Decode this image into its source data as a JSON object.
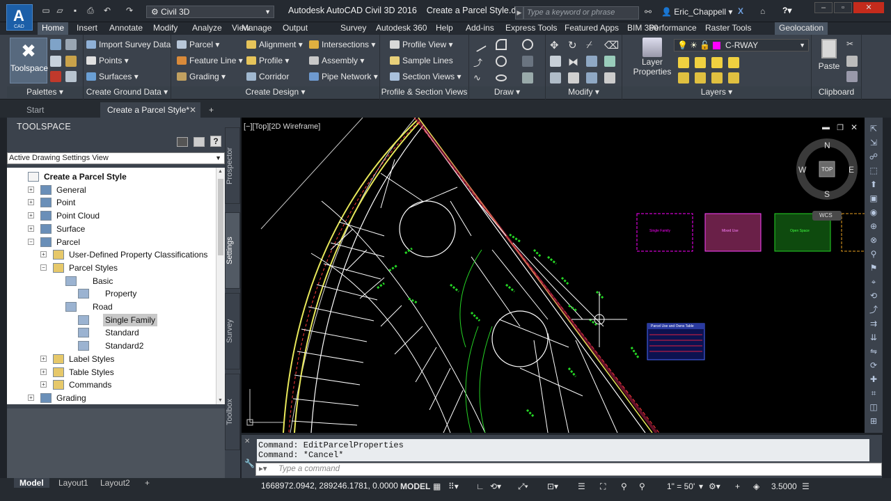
{
  "app": {
    "logo": "A",
    "logo_sub": "CAD",
    "title": "Autodesk AutoCAD Civil 3D 2016",
    "file": "Create a Parcel Style.dwg",
    "workspace": "Civil 3D",
    "search_placeholder": "Type a keyword or phrase",
    "user": "Eric_Chappell"
  },
  "ribbon_tabs": [
    "Home",
    "Insert",
    "Annotate",
    "Modify",
    "Analyze",
    "View",
    "Manage",
    "Output",
    "Survey",
    "Autodesk 360",
    "Help",
    "Add-ins",
    "Express Tools",
    "Featured Apps",
    "BIM 360",
    "Performance",
    "Raster Tools",
    "Geolocation"
  ],
  "ribbon": {
    "palettes": {
      "title": "Palettes",
      "toolspace": "Toolspace"
    },
    "ground": {
      "title": "Create Ground Data",
      "items": [
        "Import Survey Data",
        "Points",
        "Surfaces"
      ]
    },
    "design": {
      "title": "Create Design",
      "col1": [
        "Parcel",
        "Feature Line",
        "Grading"
      ],
      "col2": [
        "Alignment",
        "Profile",
        "Corridor"
      ],
      "col3": [
        "Intersections",
        "Assembly",
        "Pipe Network"
      ]
    },
    "profile": {
      "title": "Profile & Section Views",
      "items": [
        "Profile View",
        "Sample Lines",
        "Section Views"
      ]
    },
    "draw": {
      "title": "Draw"
    },
    "modify": {
      "title": "Modify"
    },
    "layers": {
      "title": "Layers",
      "props": "Layer Properties",
      "current": "C-RWAY"
    },
    "clipboard": {
      "title": "Clipboard",
      "paste": "Paste"
    }
  },
  "doc_tabs": {
    "start": "Start",
    "active": "Create a Parcel Style*"
  },
  "toolspace": {
    "title": "TOOLSPACE",
    "view": "Active Drawing Settings View",
    "tree": [
      {
        "label": "Create a Parcel Style",
        "bold": true
      },
      {
        "label": "General"
      },
      {
        "label": "Point"
      },
      {
        "label": "Point Cloud"
      },
      {
        "label": "Surface"
      },
      {
        "label": "Parcel"
      },
      {
        "label": "User-Defined Property Classifications"
      },
      {
        "label": "Parcel Styles"
      },
      {
        "label": "Basic"
      },
      {
        "label": "Property"
      },
      {
        "label": "Road"
      },
      {
        "label": "Single Family",
        "selected": true
      },
      {
        "label": "Standard"
      },
      {
        "label": "Standard2"
      },
      {
        "label": "Label Styles"
      },
      {
        "label": "Table Styles"
      },
      {
        "label": "Commands"
      },
      {
        "label": "Grading"
      }
    ],
    "side_tabs": [
      "Prospector",
      "Settings",
      "Survey",
      "Toolbox"
    ]
  },
  "viewport": {
    "label": "[−][Top][2D Wireframe]",
    "compass": {
      "n": "N",
      "s": "S",
      "e": "E",
      "w": "W",
      "top": "TOP",
      "wcs": "WCS"
    },
    "legend": [
      "Single Family",
      "Mixed Use",
      "Open Space"
    ],
    "table_title": "Parcel Use and Owns Table"
  },
  "command": {
    "history": [
      "Command: EditParcelProperties",
      "Command: *Cancel*"
    ],
    "placeholder": "Type a command"
  },
  "status": {
    "layouts": [
      "Model",
      "Layout1",
      "Layout2"
    ],
    "coords": "1668972.0942, 289246.1781, 0.0000",
    "mode": "MODEL",
    "scale": "1\" = 50'",
    "annoscale": "3.5000"
  },
  "colors": {
    "bg": "#1f2329",
    "panel": "#3b424c",
    "accent": "#4a5563",
    "canvas": "#000000",
    "lot_line": "#ffffff",
    "label_green": "#25d425",
    "road_yellow": "#e8e85a",
    "row_red": "#e02040"
  }
}
